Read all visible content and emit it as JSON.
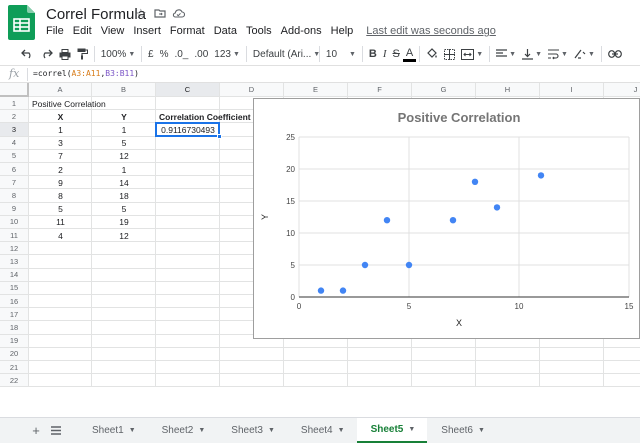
{
  "header": {
    "title": "Correl Formula",
    "last_edit": "Last edit was seconds ago",
    "menu": [
      "File",
      "Edit",
      "View",
      "Insert",
      "Format",
      "Data",
      "Tools",
      "Add-ons",
      "Help"
    ]
  },
  "toolbar": {
    "zoom": "100%",
    "currency": "£",
    "percent": "%",
    "decimal_decrease": ".0_",
    "decimal_increase": ".00",
    "more_formats": "123",
    "font": "Default (Ari...",
    "font_size": "10",
    "bold": "B",
    "italic": "I",
    "strike": "S",
    "text_color": "A"
  },
  "formula_bar": {
    "fx": "fx",
    "prefix": "=correl(",
    "ref1": "A3:A11",
    "sep": ",",
    "ref2": "B3:B11",
    "suffix": ")"
  },
  "grid": {
    "columns": [
      "A",
      "B",
      "C",
      "D",
      "E",
      "F",
      "G",
      "H",
      "I",
      "J"
    ],
    "rows": [
      "1",
      "2",
      "3",
      "4",
      "5",
      "6",
      "7",
      "8",
      "9",
      "10",
      "11",
      "12",
      "13",
      "14",
      "15",
      "16",
      "17",
      "18",
      "19",
      "20",
      "21",
      "22"
    ],
    "a1": "Positive Correlation",
    "header_x": "X",
    "header_y": "Y",
    "c2": "Correlation Coefficient",
    "c3": "0.9116730493",
    "x_values": [
      "1",
      "3",
      "7",
      "2",
      "9",
      "8",
      "5",
      "11",
      "4"
    ],
    "y_values": [
      "1",
      "5",
      "12",
      "1",
      "14",
      "18",
      "5",
      "19",
      "12"
    ]
  },
  "chart_data": {
    "type": "scatter",
    "title": "Positive Correlation",
    "xlabel": "X",
    "ylabel": "Y",
    "xlim": [
      0,
      15
    ],
    "ylim": [
      0,
      25
    ],
    "xticks": [
      "0",
      "5",
      "10",
      "15"
    ],
    "yticks": [
      "0",
      "5",
      "10",
      "15",
      "20",
      "25"
    ],
    "points": [
      [
        1,
        1
      ],
      [
        3,
        5
      ],
      [
        7,
        12
      ],
      [
        2,
        1
      ],
      [
        9,
        14
      ],
      [
        8,
        18
      ],
      [
        5,
        5
      ],
      [
        11,
        19
      ],
      [
        4,
        12
      ]
    ],
    "grid": true,
    "point_color": "#4285f4"
  },
  "tabs": {
    "sheets": [
      "Sheet1",
      "Sheet2",
      "Sheet3",
      "Sheet4",
      "Sheet5",
      "Sheet6"
    ],
    "active": "Sheet5"
  },
  "colors": {
    "accent": "#1a73e8",
    "active_tab": "#188038"
  }
}
